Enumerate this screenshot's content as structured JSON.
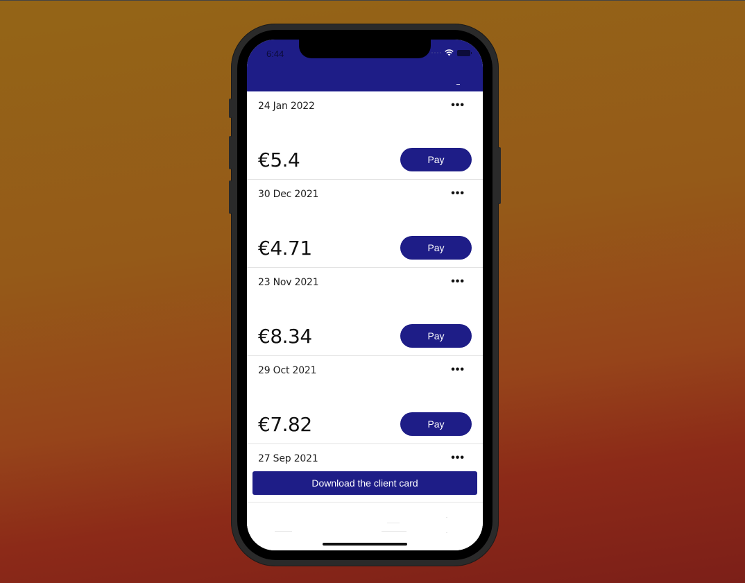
{
  "status_bar": {
    "time": "6:44",
    "icons": [
      "signal-icon",
      "wifi-icon",
      "battery-icon"
    ]
  },
  "colors": {
    "primary": "#1e1d87",
    "background_top": "#946517",
    "background_bottom": "#7c1f18"
  },
  "invoices": [
    {
      "date": "24 Jan 2022",
      "amount": "€5.4",
      "pay_label": "Pay",
      "more_label": "•••"
    },
    {
      "date": "30 Dec 2021",
      "amount": "€4.71",
      "pay_label": "Pay",
      "more_label": "•••"
    },
    {
      "date": "23 Nov 2021",
      "amount": "€8.34",
      "pay_label": "Pay",
      "more_label": "•••"
    },
    {
      "date": "29 Oct 2021",
      "amount": "€7.82",
      "pay_label": "Pay",
      "more_label": "•••"
    },
    {
      "date": "27 Sep 2021",
      "more_label": "•••"
    }
  ],
  "download": {
    "label": "Download the client card"
  }
}
